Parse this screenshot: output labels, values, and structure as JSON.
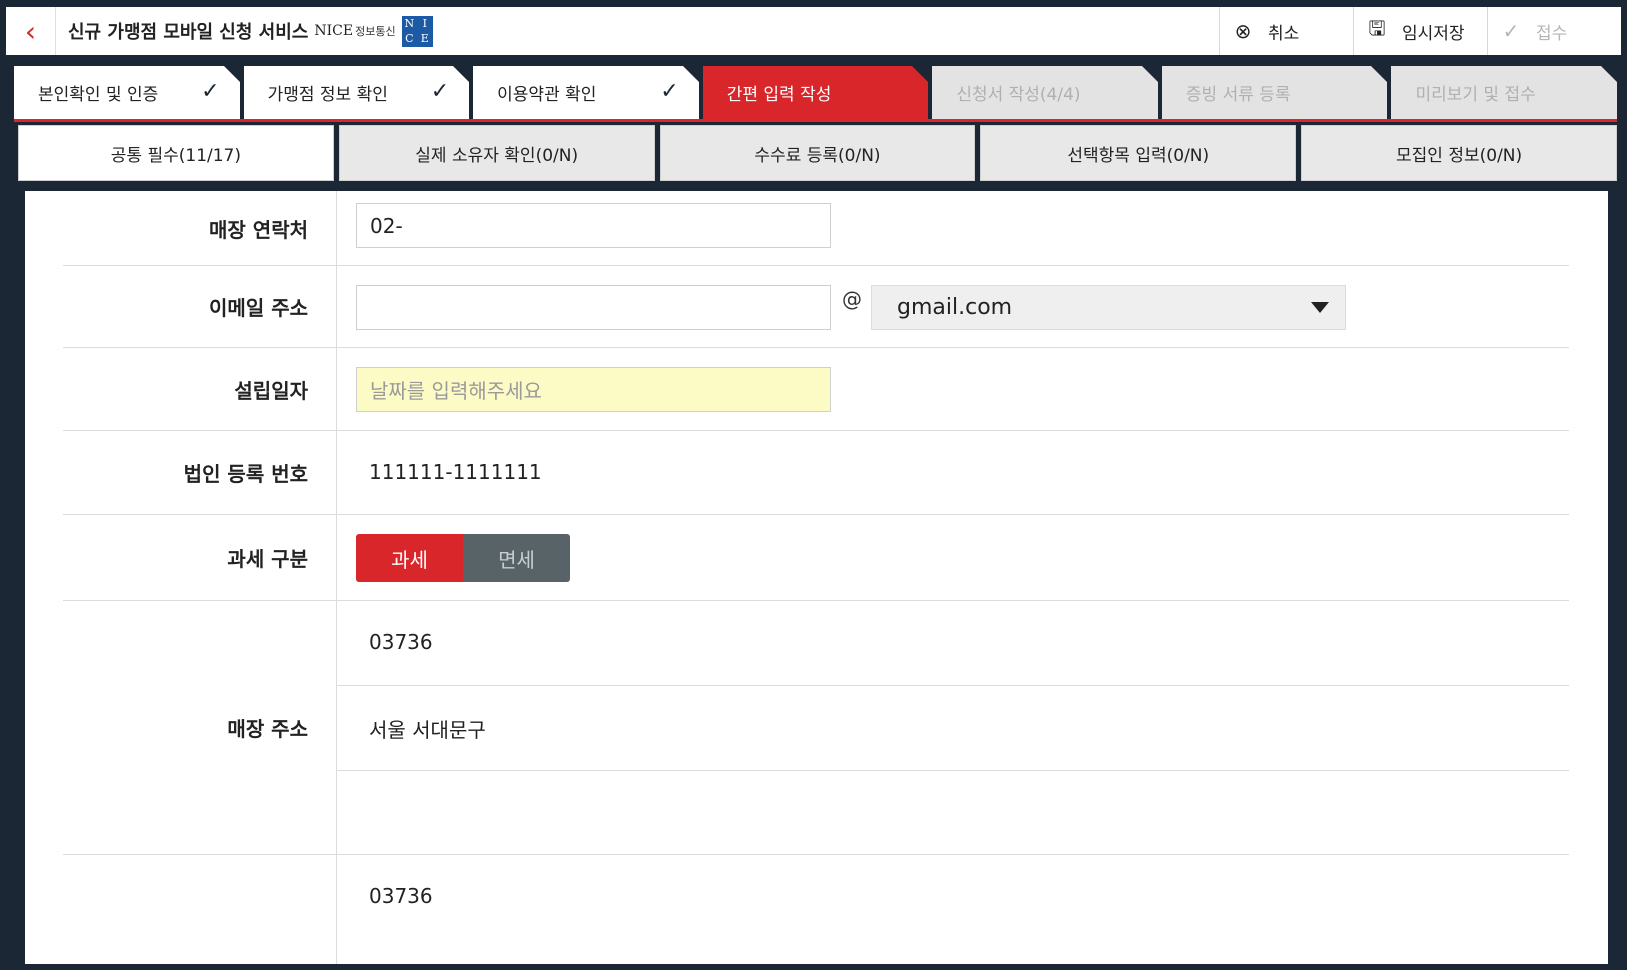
{
  "header": {
    "back_icon": "chevron-left",
    "title": "신규 가맹점 모바일 신청 서비스",
    "brand": "NICE",
    "brand_sub": "정보통신",
    "logo_letters": [
      "N",
      "I",
      "C",
      "E"
    ],
    "buttons": [
      {
        "icon": "cancel-circle-icon",
        "glyph": "⊗",
        "label": "취소"
      },
      {
        "icon": "save-disk-icon",
        "glyph": "🖫",
        "label": "임시저장"
      },
      {
        "icon": "check-circle-icon",
        "glyph": "✓",
        "label": "접수"
      }
    ]
  },
  "steps": [
    {
      "label": "본인확인 및 인증",
      "done": true
    },
    {
      "label": "가맹점 정보 확인",
      "done": true
    },
    {
      "label": "이용약관 확인",
      "done": true
    },
    {
      "label": "간편 입력 작성",
      "active": true
    },
    {
      "label": "신청서 작성(4/4)",
      "disabled": true
    },
    {
      "label": "증빙 서류 등록",
      "disabled": true
    },
    {
      "label": "미리보기 및 접수",
      "disabled": true
    }
  ],
  "check_glyph": "✓",
  "subtabs": [
    {
      "label": "공통 필수(11/17)",
      "active": true
    },
    {
      "label": "실제 소유자 확인(0/N)"
    },
    {
      "label": "수수료 등록(0/N)"
    },
    {
      "label": "선택항목 입력(0/N)"
    },
    {
      "label": "모집인 정보(0/N)"
    }
  ],
  "form": {
    "store_phone": {
      "label": "매장 연락처",
      "value": "02-"
    },
    "email": {
      "label": "이메일 주소",
      "value": "",
      "at": "@",
      "domain": "gmail.com"
    },
    "founded": {
      "label": "설립일자",
      "placeholder": "날짜를 입력해주세요"
    },
    "corp_no": {
      "label": "법인 등록 번호",
      "value": "111111-1111111"
    },
    "tax": {
      "label": "과세 구분",
      "options": [
        "과세",
        "면세"
      ],
      "selected": "과세"
    },
    "address": {
      "label": "매장 주소",
      "zip": "03736",
      "addr1": "서울 서대문구",
      "addr2": ""
    },
    "address2": {
      "label": "",
      "zip": "03736"
    }
  },
  "colors": {
    "accent": "#d9262a",
    "frame": "#1c2736",
    "highlight": "#fdfbc5"
  }
}
